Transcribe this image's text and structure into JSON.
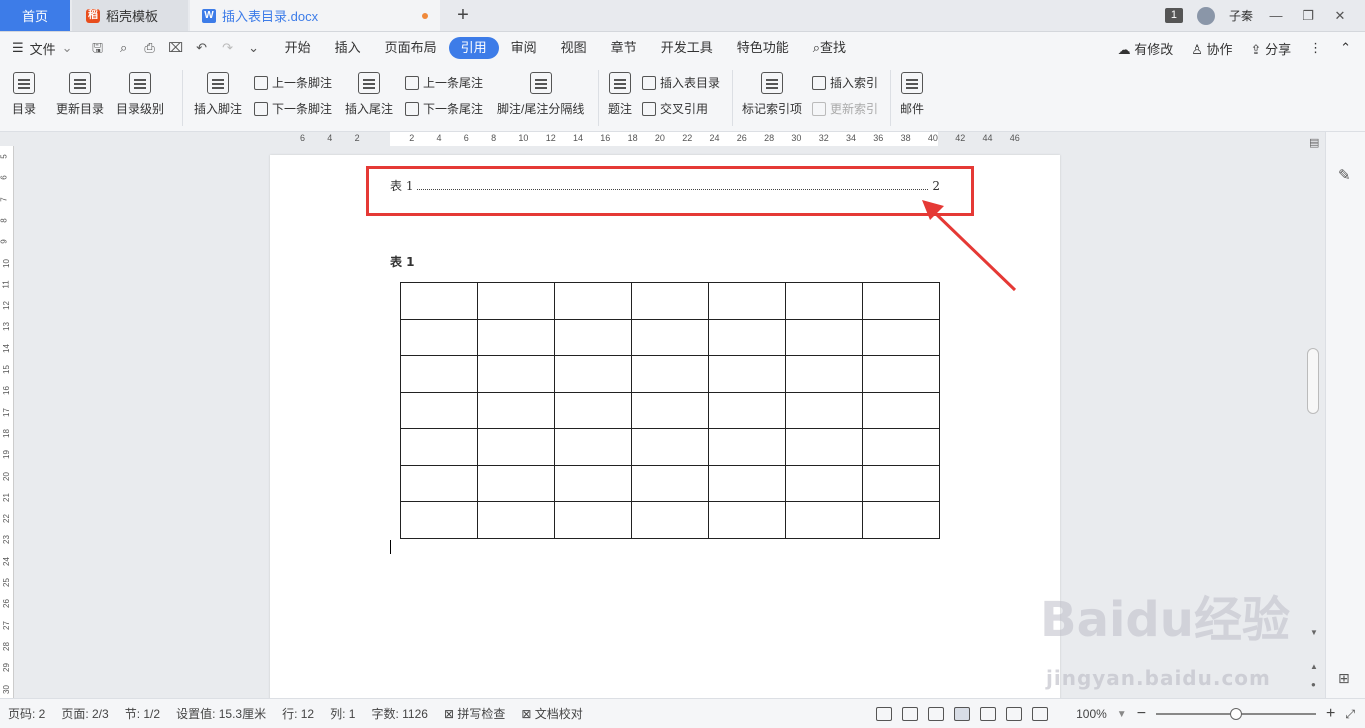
{
  "tabs": {
    "home": "首页",
    "template": "稻壳模板",
    "doc": "插入表目录.docx",
    "add": "+",
    "window_count": "1",
    "user_name": "子秦"
  },
  "menu": {
    "file": "文件",
    "tabs": [
      "开始",
      "插入",
      "页面布局",
      "引用",
      "审阅",
      "视图",
      "章节",
      "开发工具",
      "特色功能",
      "查找"
    ],
    "active_tab": "引用",
    "right": [
      "有修改",
      "协作",
      "分享"
    ]
  },
  "ribbon": {
    "toc": "目录",
    "update_toc": "更新目录",
    "toc_level": "目录级别",
    "insert_footnote": "插入脚注",
    "prev_footnote": "上一条脚注",
    "next_footnote": "下一条脚注",
    "insert_endnote": "插入尾注",
    "prev_endnote": "上一条尾注",
    "next_endnote": "下一条尾注",
    "separator": "脚注/尾注分隔线",
    "caption": "题注",
    "insert_table_toc": "插入表目录",
    "cross_ref": "交叉引用",
    "mark_index": "标记索引项",
    "insert_index": "插入索引",
    "update_index": "更新索引",
    "mail": "邮件"
  },
  "ruler": {
    "h_ticks": [
      "6",
      "4",
      "2",
      "",
      "2",
      "4",
      "6",
      "8",
      "10",
      "12",
      "14",
      "16",
      "18",
      "20",
      "22",
      "24",
      "26",
      "28",
      "30",
      "32",
      "34",
      "36",
      "38",
      "40",
      "42",
      "44",
      "46"
    ],
    "v_ticks": [
      "5",
      "6",
      "7",
      "8",
      "9",
      "10",
      "11",
      "12",
      "13",
      "14",
      "15",
      "16",
      "17",
      "18",
      "19",
      "20",
      "21",
      "22",
      "23",
      "24",
      "25",
      "26",
      "27",
      "28",
      "29",
      "30"
    ]
  },
  "document": {
    "toc_entry_label": "表 1",
    "toc_entry_page": "2",
    "caption": "表 1",
    "table_rows": 7,
    "table_cols": 7
  },
  "status": {
    "page_no": "页码: 2",
    "pages": "页面: 2/3",
    "section": "节: 1/2",
    "setting": "设置值: 15.3厘米",
    "row": "行: 12",
    "col": "列: 1",
    "words": "字数: 1126",
    "spell": "拼写检查",
    "proof": "文档校对",
    "zoom": "100%"
  },
  "watermark": {
    "brand": "Baidu经验",
    "url": "jingyan.baidu.com"
  },
  "colors": {
    "accent": "#3d7ce8",
    "highlight": "#e53935",
    "unsaved_dot": "#f0893a"
  }
}
